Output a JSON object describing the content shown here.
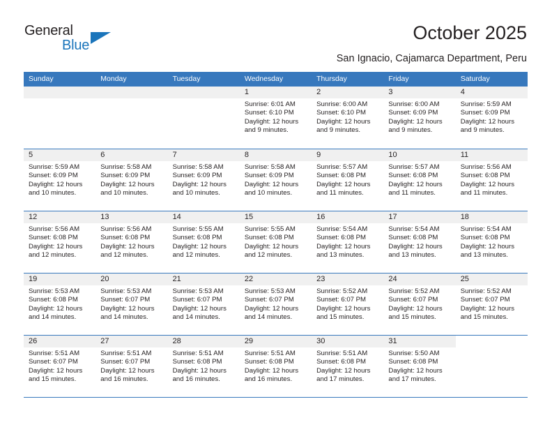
{
  "brand": {
    "name_top": "General",
    "name_bottom": "Blue"
  },
  "header": {
    "title": "October 2025",
    "subtitle": "San Ignacio, Cajamarca Department, Peru",
    "accent_color": "#3778bd",
    "brand_blue": "#1b75bb"
  },
  "calendar": {
    "weekdays": [
      "Sunday",
      "Monday",
      "Tuesday",
      "Wednesday",
      "Thursday",
      "Friday",
      "Saturday"
    ],
    "weeks": [
      [
        {
          "day": "",
          "lines": []
        },
        {
          "day": "",
          "lines": []
        },
        {
          "day": "",
          "lines": []
        },
        {
          "day": "1",
          "lines": [
            "Sunrise: 6:01 AM",
            "Sunset: 6:10 PM",
            "Daylight: 12 hours",
            "and 9 minutes."
          ]
        },
        {
          "day": "2",
          "lines": [
            "Sunrise: 6:00 AM",
            "Sunset: 6:10 PM",
            "Daylight: 12 hours",
            "and 9 minutes."
          ]
        },
        {
          "day": "3",
          "lines": [
            "Sunrise: 6:00 AM",
            "Sunset: 6:09 PM",
            "Daylight: 12 hours",
            "and 9 minutes."
          ]
        },
        {
          "day": "4",
          "lines": [
            "Sunrise: 5:59 AM",
            "Sunset: 6:09 PM",
            "Daylight: 12 hours",
            "and 9 minutes."
          ]
        }
      ],
      [
        {
          "day": "5",
          "lines": [
            "Sunrise: 5:59 AM",
            "Sunset: 6:09 PM",
            "Daylight: 12 hours",
            "and 10 minutes."
          ]
        },
        {
          "day": "6",
          "lines": [
            "Sunrise: 5:58 AM",
            "Sunset: 6:09 PM",
            "Daylight: 12 hours",
            "and 10 minutes."
          ]
        },
        {
          "day": "7",
          "lines": [
            "Sunrise: 5:58 AM",
            "Sunset: 6:09 PM",
            "Daylight: 12 hours",
            "and 10 minutes."
          ]
        },
        {
          "day": "8",
          "lines": [
            "Sunrise: 5:58 AM",
            "Sunset: 6:09 PM",
            "Daylight: 12 hours",
            "and 10 minutes."
          ]
        },
        {
          "day": "9",
          "lines": [
            "Sunrise: 5:57 AM",
            "Sunset: 6:08 PM",
            "Daylight: 12 hours",
            "and 11 minutes."
          ]
        },
        {
          "day": "10",
          "lines": [
            "Sunrise: 5:57 AM",
            "Sunset: 6:08 PM",
            "Daylight: 12 hours",
            "and 11 minutes."
          ]
        },
        {
          "day": "11",
          "lines": [
            "Sunrise: 5:56 AM",
            "Sunset: 6:08 PM",
            "Daylight: 12 hours",
            "and 11 minutes."
          ]
        }
      ],
      [
        {
          "day": "12",
          "lines": [
            "Sunrise: 5:56 AM",
            "Sunset: 6:08 PM",
            "Daylight: 12 hours",
            "and 12 minutes."
          ]
        },
        {
          "day": "13",
          "lines": [
            "Sunrise: 5:56 AM",
            "Sunset: 6:08 PM",
            "Daylight: 12 hours",
            "and 12 minutes."
          ]
        },
        {
          "day": "14",
          "lines": [
            "Sunrise: 5:55 AM",
            "Sunset: 6:08 PM",
            "Daylight: 12 hours",
            "and 12 minutes."
          ]
        },
        {
          "day": "15",
          "lines": [
            "Sunrise: 5:55 AM",
            "Sunset: 6:08 PM",
            "Daylight: 12 hours",
            "and 12 minutes."
          ]
        },
        {
          "day": "16",
          "lines": [
            "Sunrise: 5:54 AM",
            "Sunset: 6:08 PM",
            "Daylight: 12 hours",
            "and 13 minutes."
          ]
        },
        {
          "day": "17",
          "lines": [
            "Sunrise: 5:54 AM",
            "Sunset: 6:08 PM",
            "Daylight: 12 hours",
            "and 13 minutes."
          ]
        },
        {
          "day": "18",
          "lines": [
            "Sunrise: 5:54 AM",
            "Sunset: 6:08 PM",
            "Daylight: 12 hours",
            "and 13 minutes."
          ]
        }
      ],
      [
        {
          "day": "19",
          "lines": [
            "Sunrise: 5:53 AM",
            "Sunset: 6:08 PM",
            "Daylight: 12 hours",
            "and 14 minutes."
          ]
        },
        {
          "day": "20",
          "lines": [
            "Sunrise: 5:53 AM",
            "Sunset: 6:07 PM",
            "Daylight: 12 hours",
            "and 14 minutes."
          ]
        },
        {
          "day": "21",
          "lines": [
            "Sunrise: 5:53 AM",
            "Sunset: 6:07 PM",
            "Daylight: 12 hours",
            "and 14 minutes."
          ]
        },
        {
          "day": "22",
          "lines": [
            "Sunrise: 5:53 AM",
            "Sunset: 6:07 PM",
            "Daylight: 12 hours",
            "and 14 minutes."
          ]
        },
        {
          "day": "23",
          "lines": [
            "Sunrise: 5:52 AM",
            "Sunset: 6:07 PM",
            "Daylight: 12 hours",
            "and 15 minutes."
          ]
        },
        {
          "day": "24",
          "lines": [
            "Sunrise: 5:52 AM",
            "Sunset: 6:07 PM",
            "Daylight: 12 hours",
            "and 15 minutes."
          ]
        },
        {
          "day": "25",
          "lines": [
            "Sunrise: 5:52 AM",
            "Sunset: 6:07 PM",
            "Daylight: 12 hours",
            "and 15 minutes."
          ]
        }
      ],
      [
        {
          "day": "26",
          "lines": [
            "Sunrise: 5:51 AM",
            "Sunset: 6:07 PM",
            "Daylight: 12 hours",
            "and 15 minutes."
          ]
        },
        {
          "day": "27",
          "lines": [
            "Sunrise: 5:51 AM",
            "Sunset: 6:07 PM",
            "Daylight: 12 hours",
            "and 16 minutes."
          ]
        },
        {
          "day": "28",
          "lines": [
            "Sunrise: 5:51 AM",
            "Sunset: 6:08 PM",
            "Daylight: 12 hours",
            "and 16 minutes."
          ]
        },
        {
          "day": "29",
          "lines": [
            "Sunrise: 5:51 AM",
            "Sunset: 6:08 PM",
            "Daylight: 12 hours",
            "and 16 minutes."
          ]
        },
        {
          "day": "30",
          "lines": [
            "Sunrise: 5:51 AM",
            "Sunset: 6:08 PM",
            "Daylight: 12 hours",
            "and 17 minutes."
          ]
        },
        {
          "day": "31",
          "lines": [
            "Sunrise: 5:50 AM",
            "Sunset: 6:08 PM",
            "Daylight: 12 hours",
            "and 17 minutes."
          ]
        },
        {
          "day": "",
          "lines": [],
          "blank": true
        }
      ]
    ]
  }
}
